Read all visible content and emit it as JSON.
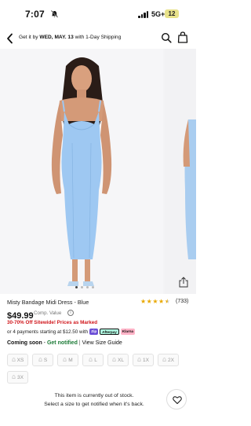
{
  "status_bar": {
    "time": "7:07",
    "network": "5G+",
    "battery": "12"
  },
  "header": {
    "shipping_prefix": "Get it by ",
    "shipping_date": "WED, MAY. 13",
    "shipping_suffix": " with 1-Day Shipping"
  },
  "product": {
    "title": "Misty Bandage Midi Dress - Blue",
    "rating_stars": 4.5,
    "review_count": "(733)",
    "price": "$49.99",
    "comp_value_label": "Comp. Value",
    "promo": "30-70% Off Sitewide! Prices as Marked",
    "installments_text": "or 4 payments starting at $12.50 with",
    "payment_badges": [
      "Zip",
      "Afterpay",
      "Klarna"
    ],
    "dress_color": "#9ec8f2"
  },
  "availability": {
    "coming_soon": "Coming soon",
    "dash": " - ",
    "get_notified": "Get notified",
    "separator": "|",
    "size_guide": "View Size Guide"
  },
  "sizes": [
    "XS",
    "S",
    "M",
    "L",
    "XL",
    "1X",
    "2X",
    "3X"
  ],
  "out_of_stock": {
    "line1": "This item is currently out of stock.",
    "line2": "Select a size to get notified when it's back."
  },
  "colors": {
    "promo_red": "#d0161b",
    "notify_green": "#1b7a36",
    "star_gold": "#e9a800"
  }
}
